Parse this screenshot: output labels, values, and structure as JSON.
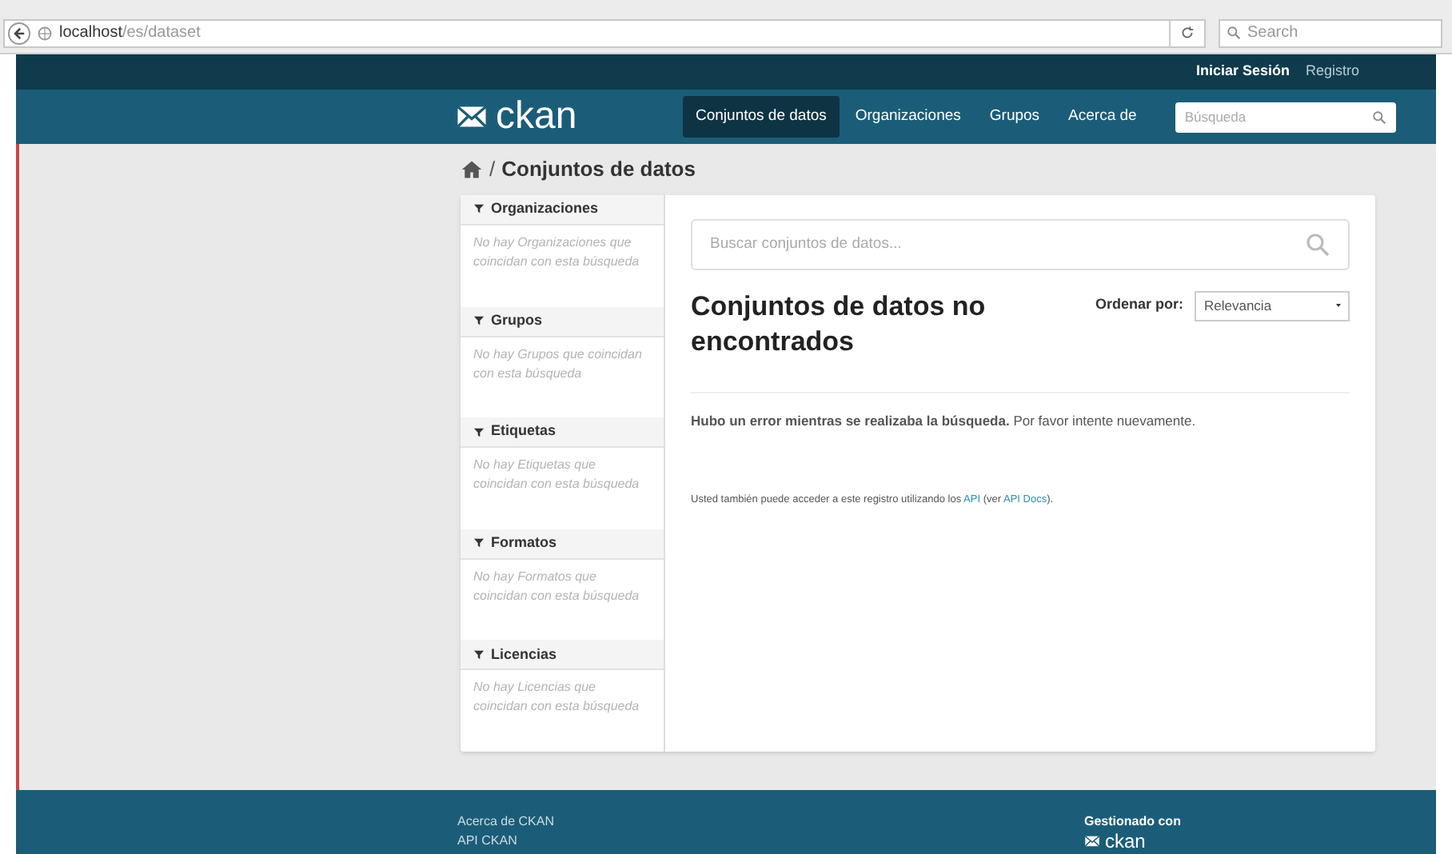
{
  "browser": {
    "url_host": "localhost",
    "url_path": "/es/dataset",
    "search_placeholder": "Search"
  },
  "account": [
    "Iniciar Sesión",
    "Registro"
  ],
  "masthead": {
    "logo": "ckan",
    "nav": [
      {
        "label": "Conjuntos de datos",
        "selected": true
      },
      {
        "label": "Organizaciones",
        "selected": false
      },
      {
        "label": "Grupos",
        "selected": false
      },
      {
        "label": "Acerca de",
        "selected": false
      }
    ],
    "search_placeholder": "Búsqueda"
  },
  "breadcrumb": {
    "separator": "/",
    "label": "Conjuntos de datos"
  },
  "facets": [
    {
      "title": "Organizaciones",
      "empty": "No hay Organizaciones que coincidan con esta búsqueda"
    },
    {
      "title": "Grupos",
      "empty": "No hay Grupos que coincidan con esta búsqueda"
    },
    {
      "title": "Etiquetas",
      "empty": "No hay Etiquetas que coincidan con esta búsqueda"
    },
    {
      "title": "Formatos",
      "empty": "No hay Formatos que coincidan con esta búsqueda"
    },
    {
      "title": "Licencias",
      "empty": "No hay Licencias que coincidan con esta búsqueda"
    }
  ],
  "main": {
    "search_placeholder": "Buscar conjuntos de datos...",
    "heading": "Conjuntos de datos no encontrados",
    "sort_label": "Ordenar por:",
    "sort_value": "Relevancia",
    "error": "**Hubo un error mientras se realizaba la búsqueda.** Por favor intente nuevamente.",
    "api_note": {
      "before": "Usted también puede acceder a este registro utilizando los ",
      "link_1": "API",
      "middle": " (ver ",
      "link_2": "API Docs",
      "after": ")."
    }
  },
  "footer": {
    "links": [
      "Acerca de CKAN",
      "API CKAN"
    ],
    "powered_label": "Gestionado con",
    "powered_logo": "ckan"
  }
}
